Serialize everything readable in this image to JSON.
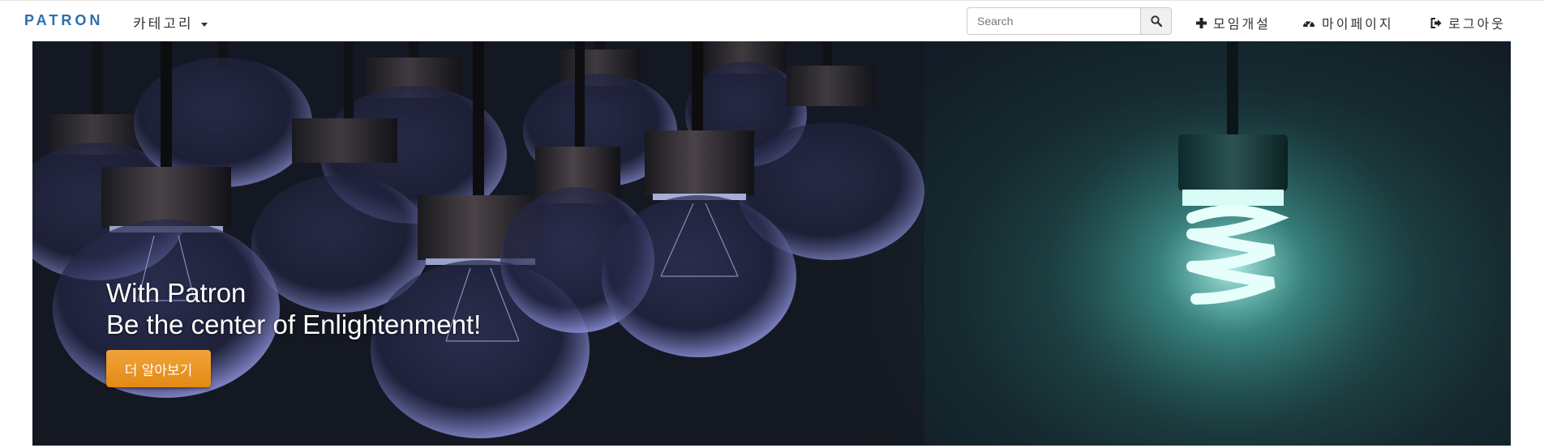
{
  "navbar": {
    "brand": "PATRON",
    "category_label": "카테고리",
    "search": {
      "placeholder": "Search",
      "value": ""
    },
    "links": {
      "new_meeting": "모임개설",
      "mypage": "마이페이지",
      "logout": "로그아웃"
    },
    "icons": {
      "category_caret": "caret-down-icon",
      "search": "search-icon",
      "new_meeting": "plus-icon",
      "mypage": "dashboard-icon",
      "logout": "logout-icon"
    }
  },
  "hero": {
    "line1": "With Patron",
    "line2": "Be the center of Enlightenment!",
    "button_label": "더 알아보기",
    "colors": {
      "button": "#f0a030",
      "brand": "#2a6fb0",
      "glow": "#3fb0a8"
    }
  }
}
